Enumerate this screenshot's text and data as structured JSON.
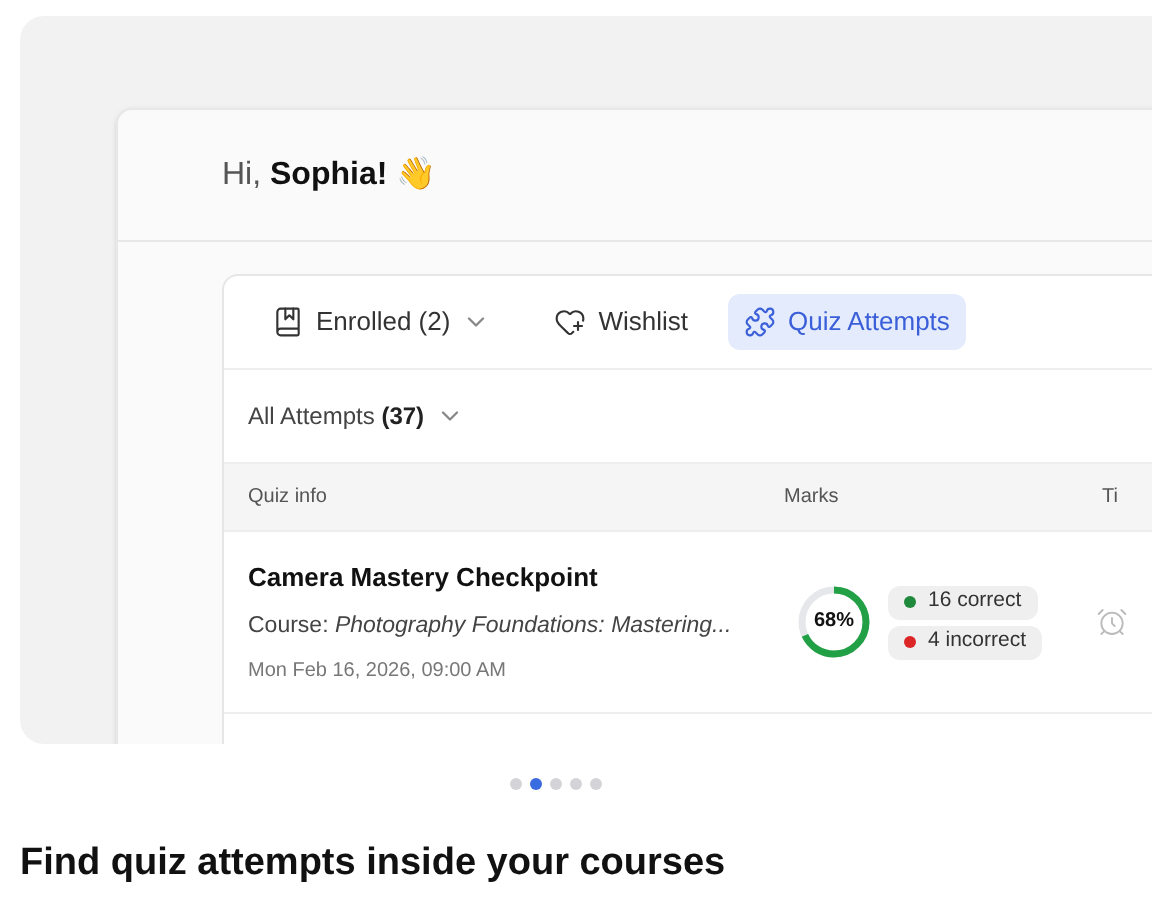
{
  "greeting": {
    "prefix": "Hi, ",
    "name": "Sophia!",
    "emoji": "👋"
  },
  "tabs": [
    {
      "label": "Enrolled (2)",
      "selected": false,
      "dropdown": true
    },
    {
      "label": "Wishlist",
      "selected": false,
      "dropdown": false
    },
    {
      "label": "Quiz Attempts",
      "selected": true,
      "dropdown": false
    }
  ],
  "filter": {
    "label": "All Attempts",
    "count": "(37)"
  },
  "table": {
    "columns": [
      "Quiz info",
      "Marks",
      "Ti"
    ],
    "rows": [
      {
        "title": "Camera Mastery Checkpoint",
        "course": "Course: *Photography Foundations: Mastering...*",
        "date": "Mon Feb 16, 2026, 09:00 AM",
        "score": "68%",
        "results": [
          {
            "label": "16 correct",
            "color": "#1f8a3b"
          },
          {
            "label": "4 incorrect",
            "color": "#dc2626"
          }
        ]
      }
    ]
  },
  "carousel": [
    {
      "selected": false
    },
    {
      "selected": true
    },
    {
      "selected": false
    },
    {
      "selected": false
    },
    {
      "selected": false
    }
  ],
  "caption": "Find quiz attempts inside your courses"
}
